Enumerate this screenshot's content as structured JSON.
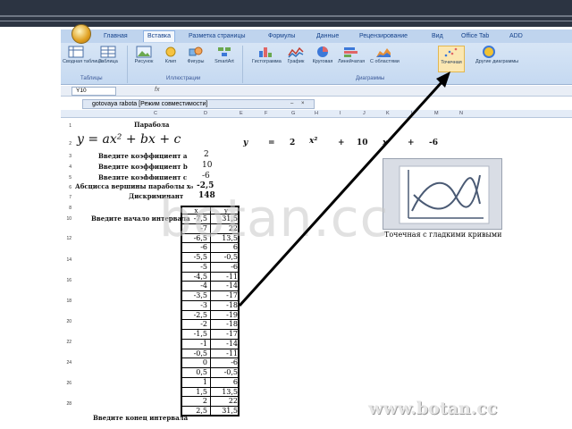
{
  "ribbon": {
    "tabs": [
      "Главная",
      "Вставка",
      "Разметка страницы",
      "Формулы",
      "Данные",
      "Рецензирование",
      "Вид",
      "Office Tab",
      "ADD"
    ],
    "active_tab": "Вставка",
    "buttons": {
      "pivot": "Сводная таблица",
      "table": "Таблица",
      "picture": "Рисунок",
      "clip": "Клип",
      "shapes": "Фигуры",
      "smartart": "SmartArt",
      "histogram": "Гистограмма",
      "graph": "График",
      "pie": "Круговая",
      "bar": "Линейчатая",
      "area": "С областями",
      "scatter": "Точечная",
      "other": "Другие диаграммы"
    },
    "groups": {
      "tables": "Таблицы",
      "illustrations": "Иллюстрации",
      "charts": "Диаграммы"
    }
  },
  "formula_bar": {
    "name_box": "Y10",
    "fx": "fx"
  },
  "workbook": {
    "title": "gotovaya rabota  [Режим совместимости]"
  },
  "columns": [
    "C",
    "D",
    "E",
    "F",
    "G",
    "H",
    "I",
    "J",
    "K",
    "L",
    "M",
    "N"
  ],
  "sheet": {
    "heading": "Парабола",
    "formula": "y = ax² + bx + c",
    "labels": {
      "coef_a": "Введите коэффициент a",
      "coef_b": "Введите коэффициент b",
      "coef_c": "Введите коэффициент c",
      "vertex": "Абсцисса вершины параболы x₀",
      "discriminant": "Дискриминант",
      "start": "Введите начало интервала",
      "end": "Введите конец интервала"
    },
    "values": {
      "a": "2",
      "b": "10",
      "c": "-6",
      "vertex": "-2,5",
      "discriminant": "148"
    },
    "equation_row": [
      "y",
      "=",
      "2",
      "x²",
      "+",
      "10",
      "x",
      "+",
      "-6"
    ],
    "xy_header": {
      "x": "x",
      "y": "y"
    },
    "xy_rows": [
      [
        "-7,5",
        "31,5"
      ],
      [
        "-7",
        "22"
      ],
      [
        "-6,5",
        "13,5"
      ],
      [
        "-6",
        "6"
      ],
      [
        "-5,5",
        "-0,5"
      ],
      [
        "-5",
        "-6"
      ],
      [
        "-4,5",
        "-11"
      ],
      [
        "-4",
        "-14"
      ],
      [
        "-3,5",
        "-17"
      ],
      [
        "-3",
        "-18"
      ],
      [
        "-2,5",
        "-19"
      ],
      [
        "-2",
        "-18"
      ],
      [
        "-1,5",
        "-17"
      ],
      [
        "-1",
        "-14"
      ],
      [
        "-0,5",
        "-11"
      ],
      [
        "0",
        "-6"
      ],
      [
        "0,5",
        "-0,5"
      ],
      [
        "1",
        "6"
      ],
      [
        "1,5",
        "13,5"
      ],
      [
        "2",
        "22"
      ],
      [
        "2,5",
        "31,5"
      ]
    ]
  },
  "chart_preview": {
    "caption": "Точечная с гладкими кривыми"
  },
  "watermark": {
    "main": "botan.cc",
    "url": "www.botan.cc"
  },
  "colors": {
    "header_band": "#2c3442",
    "ribbon": "#c5d9f1",
    "arrow": "#000000"
  }
}
